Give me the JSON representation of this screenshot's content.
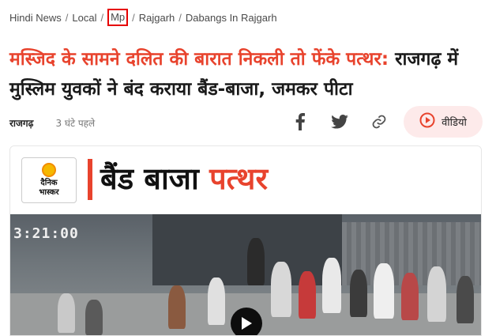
{
  "breadcrumb": {
    "items": [
      {
        "label": "Hindi News",
        "highlighted": false
      },
      {
        "label": "Local",
        "highlighted": false
      },
      {
        "label": "Mp",
        "highlighted": true
      },
      {
        "label": "Rajgarh",
        "highlighted": false
      },
      {
        "label": "Dabangs In Rajgarh",
        "highlighted": false
      }
    ],
    "separator": "/",
    "highlight_color": "#e60000"
  },
  "article": {
    "headline_highlight": "मस्जिद के सामने दलित की बारात निकली तो फेंके पत्थर:",
    "headline_rest": " राजगढ़ में मुस्लिम युवकों ने बंद कराया बैंड-बाजा, जमकर पीटा",
    "highlight_color": "#e8432d",
    "location": "राजगढ़",
    "time_ago": "3 घंटे पहले"
  },
  "share": {
    "icons": [
      "facebook-icon",
      "twitter-icon",
      "copy-link-icon"
    ]
  },
  "video_button": {
    "label": "वीडियो",
    "icon": "play-circle-icon",
    "background": "#fdeaea",
    "accent": "#e8432d"
  },
  "media": {
    "logo_line1": "दैनिक",
    "logo_line2": "भास्कर",
    "banner_black": "बैंड बाजा ",
    "banner_red": "पत्थर",
    "timestamp": "3:21:00",
    "play_icon": "play-icon"
  }
}
